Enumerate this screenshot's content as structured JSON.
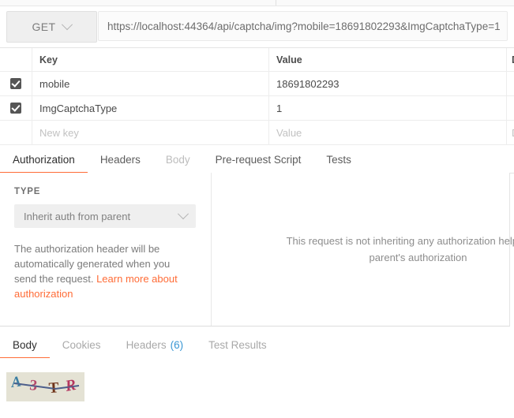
{
  "request": {
    "method": "GET",
    "url": "https://localhost:44364/api/captcha/img?mobile=18691802293&ImgCaptchaType=1"
  },
  "params_table": {
    "columns": [
      "Key",
      "Value",
      "D"
    ],
    "rows": [
      {
        "checked": true,
        "key": "mobile",
        "value": "18691802293",
        "description": ""
      },
      {
        "checked": true,
        "key": "ImgCaptchaType",
        "value": "1",
        "description": ""
      }
    ],
    "new_row": {
      "key_placeholder": "New key",
      "value_placeholder": "Value",
      "desc_placeholder": "D"
    }
  },
  "request_tabs": [
    {
      "label": "Authorization",
      "state": "active"
    },
    {
      "label": "Headers",
      "state": "normal"
    },
    {
      "label": "Body",
      "state": "dim"
    },
    {
      "label": "Pre-request Script",
      "state": "normal"
    },
    {
      "label": "Tests",
      "state": "normal"
    }
  ],
  "authorization": {
    "type_label": "TYPE",
    "type_value": "Inherit auth from parent",
    "help_text": "The authorization header will be automatically generated when you send the request. ",
    "help_link": "Learn more about authorization",
    "right_line1": "This request is not inheriting any authorization helper at th",
    "right_line2": "parent's authorization"
  },
  "response_tabs": [
    {
      "label": "Body",
      "state": "active",
      "count": ""
    },
    {
      "label": "Cookies",
      "state": "normal",
      "count": ""
    },
    {
      "label": "Headers",
      "state": "normal",
      "count": "(6)"
    },
    {
      "label": "Test Results",
      "state": "normal",
      "count": ""
    }
  ],
  "response_body": {
    "captcha_text": "A3TR",
    "captcha_chars": [
      {
        "glyph": "A",
        "color": "#3c7fa3"
      },
      {
        "glyph": "3",
        "color": "#b5496b"
      },
      {
        "glyph": "T",
        "color": "#6e3218"
      },
      {
        "glyph": "R",
        "color": "#b5365f"
      }
    ],
    "captcha_bg": "#e4e2d4",
    "captcha_line_color": "#4e5f8c"
  },
  "colors": {
    "accent": "#ff6c37",
    "link_blue": "#3a97d4",
    "checkbox": "#555555"
  }
}
